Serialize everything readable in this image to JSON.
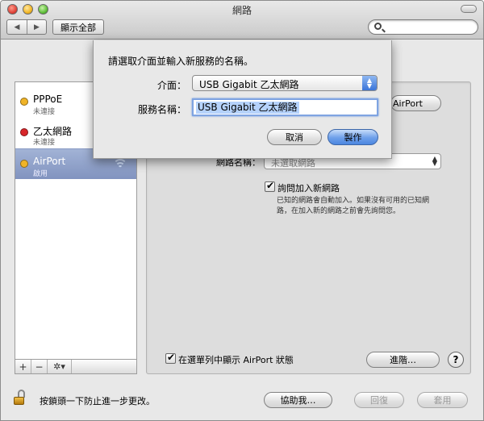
{
  "window": {
    "title": "網路",
    "nav_back": "◀",
    "nav_forward": "▶",
    "show_all": "顯示全部",
    "search": {
      "value": "",
      "placeholder": ""
    }
  },
  "sidebar": {
    "items": [
      {
        "name": "PPPoE",
        "status": "未連接",
        "status_color": "#f0b428",
        "selected": false
      },
      {
        "name": "乙太網路",
        "status": "未連接",
        "status_color": "#d8262a",
        "selected": false
      },
      {
        "name": "AirPort",
        "status": "啟用",
        "status_color": "#f0b428",
        "selected": true
      }
    ],
    "add": "+",
    "remove": "−",
    "action": "✲▾"
  },
  "detail": {
    "airport_button": "AirPort",
    "network_name_label": "網路名稱：",
    "network_name_value": "未選取網路",
    "ask_join_label": "詢問加入新網路",
    "ask_join_checked": true,
    "ask_join_desc": "已知的網路會自動加入。如果沒有可用的已知網路，在加入新的網路之前會先詢問您。",
    "show_menubar_label": "在選單列中顯示 AirPort 狀態",
    "show_menubar_checked": true,
    "advanced_button": "進階…",
    "help_button": "?"
  },
  "bottom": {
    "lock_text": "按鎖頭一下防止進一步更改。",
    "assist_button": "協助我…",
    "revert_button": "回復",
    "apply_button": "套用"
  },
  "sheet": {
    "prompt": "請選取介面並輸入新服務的名稱。",
    "interface_label": "介面：",
    "interface_value": "USB Gigabit 乙太網路",
    "service_name_label": "服務名稱：",
    "service_name_value": "USB Gigabit 乙太網路",
    "cancel_button": "取消",
    "create_button": "製作"
  },
  "colors": {
    "accent": "#4c86e0",
    "selection": "#8193bf"
  }
}
